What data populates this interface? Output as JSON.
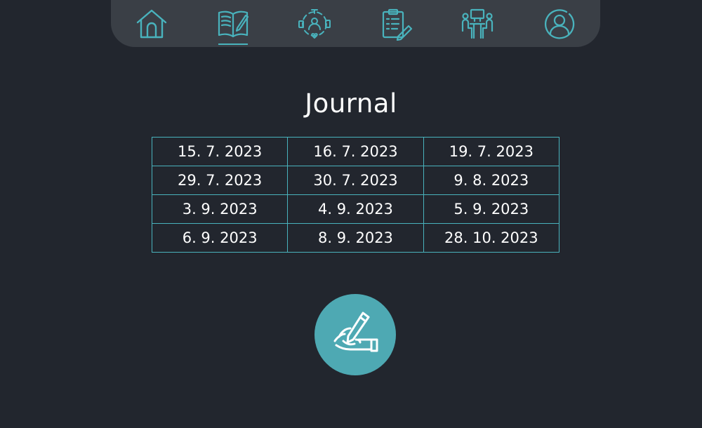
{
  "nav": {
    "items": [
      {
        "id": "home",
        "icon": "home-icon"
      },
      {
        "id": "journal",
        "icon": "open-book-pen-icon",
        "active": true
      },
      {
        "id": "wellbeing",
        "icon": "wellbeing-circle-icon"
      },
      {
        "id": "checklist",
        "icon": "clipboard-checklist-icon"
      },
      {
        "id": "meeting",
        "icon": "meeting-table-icon"
      },
      {
        "id": "profile",
        "icon": "user-profile-icon"
      }
    ],
    "accent_color": "#49b3bd",
    "background_color": "#3a3f46"
  },
  "page": {
    "title": "Journal",
    "background_color": "#22262e"
  },
  "entries": {
    "rows": [
      [
        "15. 7. 2023",
        "16. 7. 2023",
        "19. 7. 2023"
      ],
      [
        "29. 7. 2023",
        "30. 7. 2023",
        "9. 8. 2023"
      ],
      [
        "3. 9. 2023",
        "4. 9. 2023",
        "5. 9. 2023"
      ],
      [
        "6. 9. 2023",
        "8. 9. 2023",
        "28. 10. 2023"
      ]
    ],
    "border_color": "#49b3bd"
  },
  "new_entry_button": {
    "icon": "hand-writing-icon",
    "color": "#4ea9b3"
  }
}
